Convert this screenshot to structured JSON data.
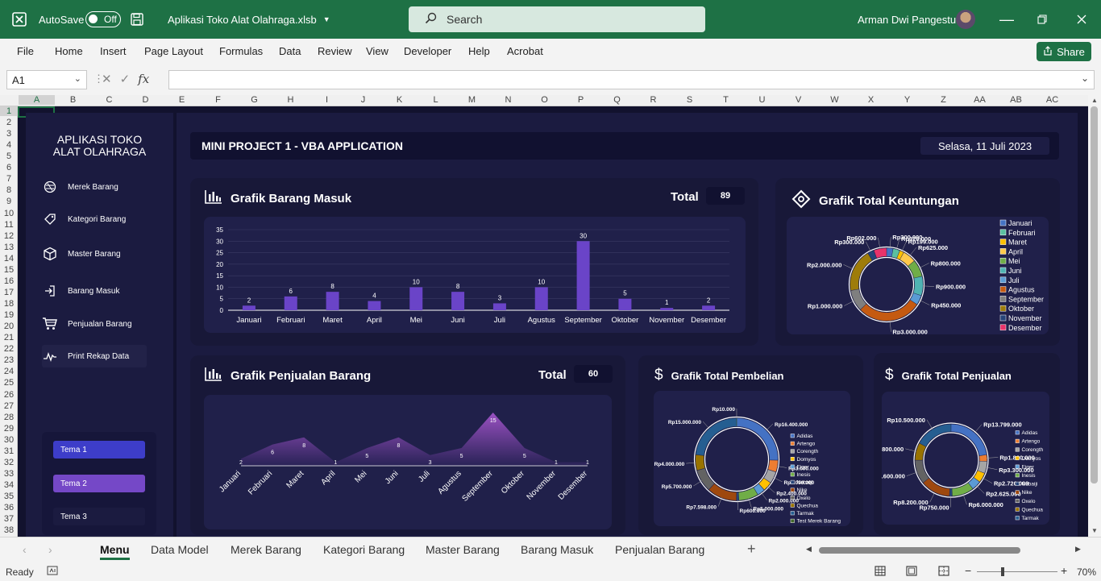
{
  "window": {
    "autosave_label": "AutoSave",
    "autosave_state": "Off",
    "filename": "Aplikasi Toko Alat Olahraga.xlsb",
    "search_placeholder": "Search",
    "user_name": "Arman Dwi Pangestu"
  },
  "ribbon": {
    "tabs": [
      "File",
      "Home",
      "Insert",
      "Page Layout",
      "Formulas",
      "Data",
      "Review",
      "View",
      "Developer",
      "Help",
      "Acrobat"
    ],
    "share_label": "Share"
  },
  "formula_bar": {
    "name_box": "A1",
    "fx_label": "fx",
    "formula": ""
  },
  "grid": {
    "columns": [
      "A",
      "B",
      "C",
      "D",
      "E",
      "F",
      "G",
      "H",
      "I",
      "J",
      "K",
      "L",
      "M",
      "N",
      "O",
      "P",
      "Q",
      "R",
      "S",
      "T",
      "U",
      "V",
      "W",
      "X",
      "Y",
      "Z",
      "AA",
      "AB",
      "AC"
    ],
    "rows": [
      "1",
      "2",
      "3",
      "4",
      "5",
      "6",
      "7",
      "8",
      "9",
      "10",
      "11",
      "12",
      "13",
      "14",
      "15",
      "16",
      "17",
      "18",
      "19",
      "20",
      "21",
      "22",
      "23",
      "24",
      "25",
      "26",
      "27",
      "28",
      "29",
      "30",
      "31",
      "32",
      "33",
      "34",
      "35",
      "36",
      "37",
      "38"
    ],
    "selected_cell": "A1"
  },
  "sidebar": {
    "title_line1": "APLIKASI TOKO",
    "title_line2": "ALAT OLAHRAGA",
    "items": [
      {
        "label": "Merek Barang",
        "icon": "record-icon"
      },
      {
        "label": "Kategori Barang",
        "icon": "tag-icon"
      },
      {
        "label": "Master Barang",
        "icon": "box-icon"
      },
      {
        "label": "Barang Masuk",
        "icon": "enter-icon"
      },
      {
        "label": "Penjualan Barang",
        "icon": "cart-icon"
      },
      {
        "label": "Print Rekap Data",
        "icon": "pulse-icon"
      }
    ],
    "themes": [
      "Tema 1",
      "Tema 2",
      "Tema 3"
    ]
  },
  "header": {
    "title": "MINI PROJECT 1 - VBA APPLICATION",
    "date": "Selasa, 11 Juli 2023"
  },
  "colors": {
    "excel_green": "#1e7145",
    "bar_purple": "#6a44c8",
    "dashboard_bg": "#12122e"
  },
  "panels": {
    "barang_masuk": {
      "title": "Grafik Barang Masuk",
      "total_label": "Total",
      "total_value": "89"
    },
    "keuntungan": {
      "title": "Grafik Total Keuntungan"
    },
    "penjualan_barang": {
      "title": "Grafik Penjualan Barang",
      "total_label": "Total",
      "total_value": "60"
    },
    "pembelian": {
      "title": "Grafik Total Pembelian"
    },
    "total_penjualan": {
      "title": "Grafik Total Penjualan"
    }
  },
  "chart_data": [
    {
      "id": "barang_masuk",
      "type": "bar",
      "categories": [
        "Januari",
        "Februari",
        "Maret",
        "April",
        "Mei",
        "Juni",
        "Juli",
        "Agustus",
        "September",
        "Oktober",
        "November",
        "Desember"
      ],
      "values": [
        2,
        6,
        8,
        4,
        10,
        8,
        3,
        10,
        30,
        5,
        1,
        2
      ],
      "ylim": [
        0,
        35
      ],
      "yticks": [
        "0",
        "5",
        "10",
        "15",
        "20",
        "25",
        "30",
        "35"
      ],
      "grid": true,
      "bar_color": "#6a44c8"
    },
    {
      "id": "penjualan_barang",
      "type": "area",
      "categories": [
        "Januari",
        "Februari",
        "Maret",
        "April",
        "Mei",
        "Juni",
        "Juli",
        "Agustus",
        "September",
        "Oktober",
        "November",
        "Desember"
      ],
      "values": [
        2,
        6,
        8,
        1,
        5,
        8,
        3,
        5,
        15,
        5,
        1,
        1
      ]
    },
    {
      "id": "keuntungan",
      "type": "pie",
      "style": "donut",
      "legend_position": "right",
      "categories": [
        "Januari",
        "Februari",
        "Maret",
        "April",
        "Mei",
        "Juni",
        "Juli",
        "Agustus",
        "September",
        "Oktober",
        "November",
        "Desember"
      ],
      "values": [
        300000,
        320000,
        199000,
        625000,
        800000,
        900000,
        450000,
        3000000,
        1000000,
        2000000,
        300000,
        602000
      ],
      "labels": [
        "Rp300.000",
        "Rp320.000",
        "Rp199.000",
        "Rp625.000",
        "Rp800.000",
        "Rp900.000",
        "Rp450.000",
        "Rp3.000.000",
        "Rp1.000.000",
        "Rp2.000.000",
        "Rp300.000",
        "Rp602.000"
      ],
      "colors": [
        "#4472c4",
        "#5bc0a0",
        "#ffc000",
        "#ffc94a",
        "#70ad47",
        "#4fb3b3",
        "#5a9bd5",
        "#c55a11",
        "#7f7f7f",
        "#9e7c0a",
        "#264478",
        "#e8336a"
      ]
    },
    {
      "id": "pembelian",
      "type": "pie",
      "style": "donut",
      "legend_position": "right",
      "categories": [
        "Adidas",
        "Artengo",
        "Corength",
        "Domyos",
        "Eiger",
        "Inesis",
        "Nabaiji",
        "Nike",
        "Oxelo",
        "Quechua",
        "Tarmak",
        "Test Merek Barang"
      ],
      "values": [
        16400000,
        3000000,
        3000000,
        2400000,
        2000000,
        5000000,
        600000,
        7598000,
        5700000,
        4000000,
        15000000,
        10000
      ],
      "labels": [
        "Rp16.400.000",
        "Rp3.000.000",
        "Rp3.000.000",
        "Rp2.400.000",
        "Rp2.000.000",
        "Rp5.000.000",
        "Rp600.000",
        "Rp7.598.000",
        "Rp5.700.000",
        "Rp4.000.000",
        "Rp15.000.000",
        "Rp10.000"
      ],
      "colors": [
        "#4472c4",
        "#ed7d31",
        "#a5a5a5",
        "#ffc000",
        "#5b9bd5",
        "#70ad47",
        "#264478",
        "#9e480e",
        "#636363",
        "#997300",
        "#255e91",
        "#43682b"
      ]
    },
    {
      "id": "total_penjualan",
      "type": "pie",
      "style": "donut",
      "legend_position": "right",
      "categories": [
        "Adidas",
        "Artengo",
        "Corength",
        "Domyos",
        "Eiger",
        "Inesis",
        "Nabaiji",
        "Nike",
        "Oxelo",
        "Quechua",
        "Tarmak"
      ],
      "values": [
        13799000,
        1800000,
        3300000,
        2720000,
        2625000,
        6000000,
        750000,
        8200000,
        6600000,
        4800000,
        10500000
      ],
      "labels": [
        "Rp13.799.000",
        "Rp1.800.000",
        "Rp3.300.000",
        "Rp2.720.000",
        "Rp2.625.000",
        "Rp6.000.000",
        "Rp750.000",
        "Rp8.200.000",
        "Rp6.600.000",
        "Rp4.800.000",
        "Rp10.500.000"
      ],
      "colors": [
        "#4472c4",
        "#ed7d31",
        "#a5a5a5",
        "#ffc000",
        "#5b9bd5",
        "#70ad47",
        "#264478",
        "#9e480e",
        "#636363",
        "#997300",
        "#255e91"
      ]
    }
  ],
  "sheet_tabs": [
    "Menu",
    "Data Model",
    "Merek Barang",
    "Kategori Barang",
    "Master Barang",
    "Barang Masuk",
    "Penjualan Barang"
  ],
  "status": {
    "ready": "Ready",
    "zoom": "70%"
  }
}
